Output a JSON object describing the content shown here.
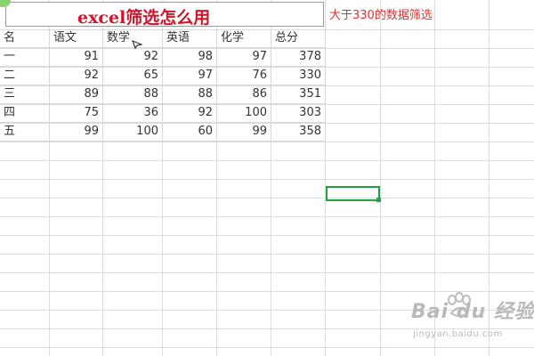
{
  "title": "excel筛选怎么用",
  "note": "大于330的数据筛选",
  "table": {
    "headers": [
      "名",
      "语文",
      "数学",
      "英语",
      "化学",
      "总分"
    ],
    "rows": [
      [
        "一",
        "91",
        "92",
        "98",
        "97",
        "378"
      ],
      [
        "二",
        "92",
        "65",
        "97",
        "76",
        "330"
      ],
      [
        "三",
        "89",
        "88",
        "88",
        "86",
        "351"
      ],
      [
        "四",
        "75",
        "36",
        "92",
        "100",
        "303"
      ],
      [
        "五",
        "99",
        "100",
        "60",
        "99",
        "358"
      ]
    ]
  },
  "watermark": {
    "logo": "Bai du 经验",
    "url": "jingyan.baidu.com"
  },
  "colors": {
    "title": "#d3142a",
    "note": "#e03030",
    "selection": "#21a045"
  }
}
